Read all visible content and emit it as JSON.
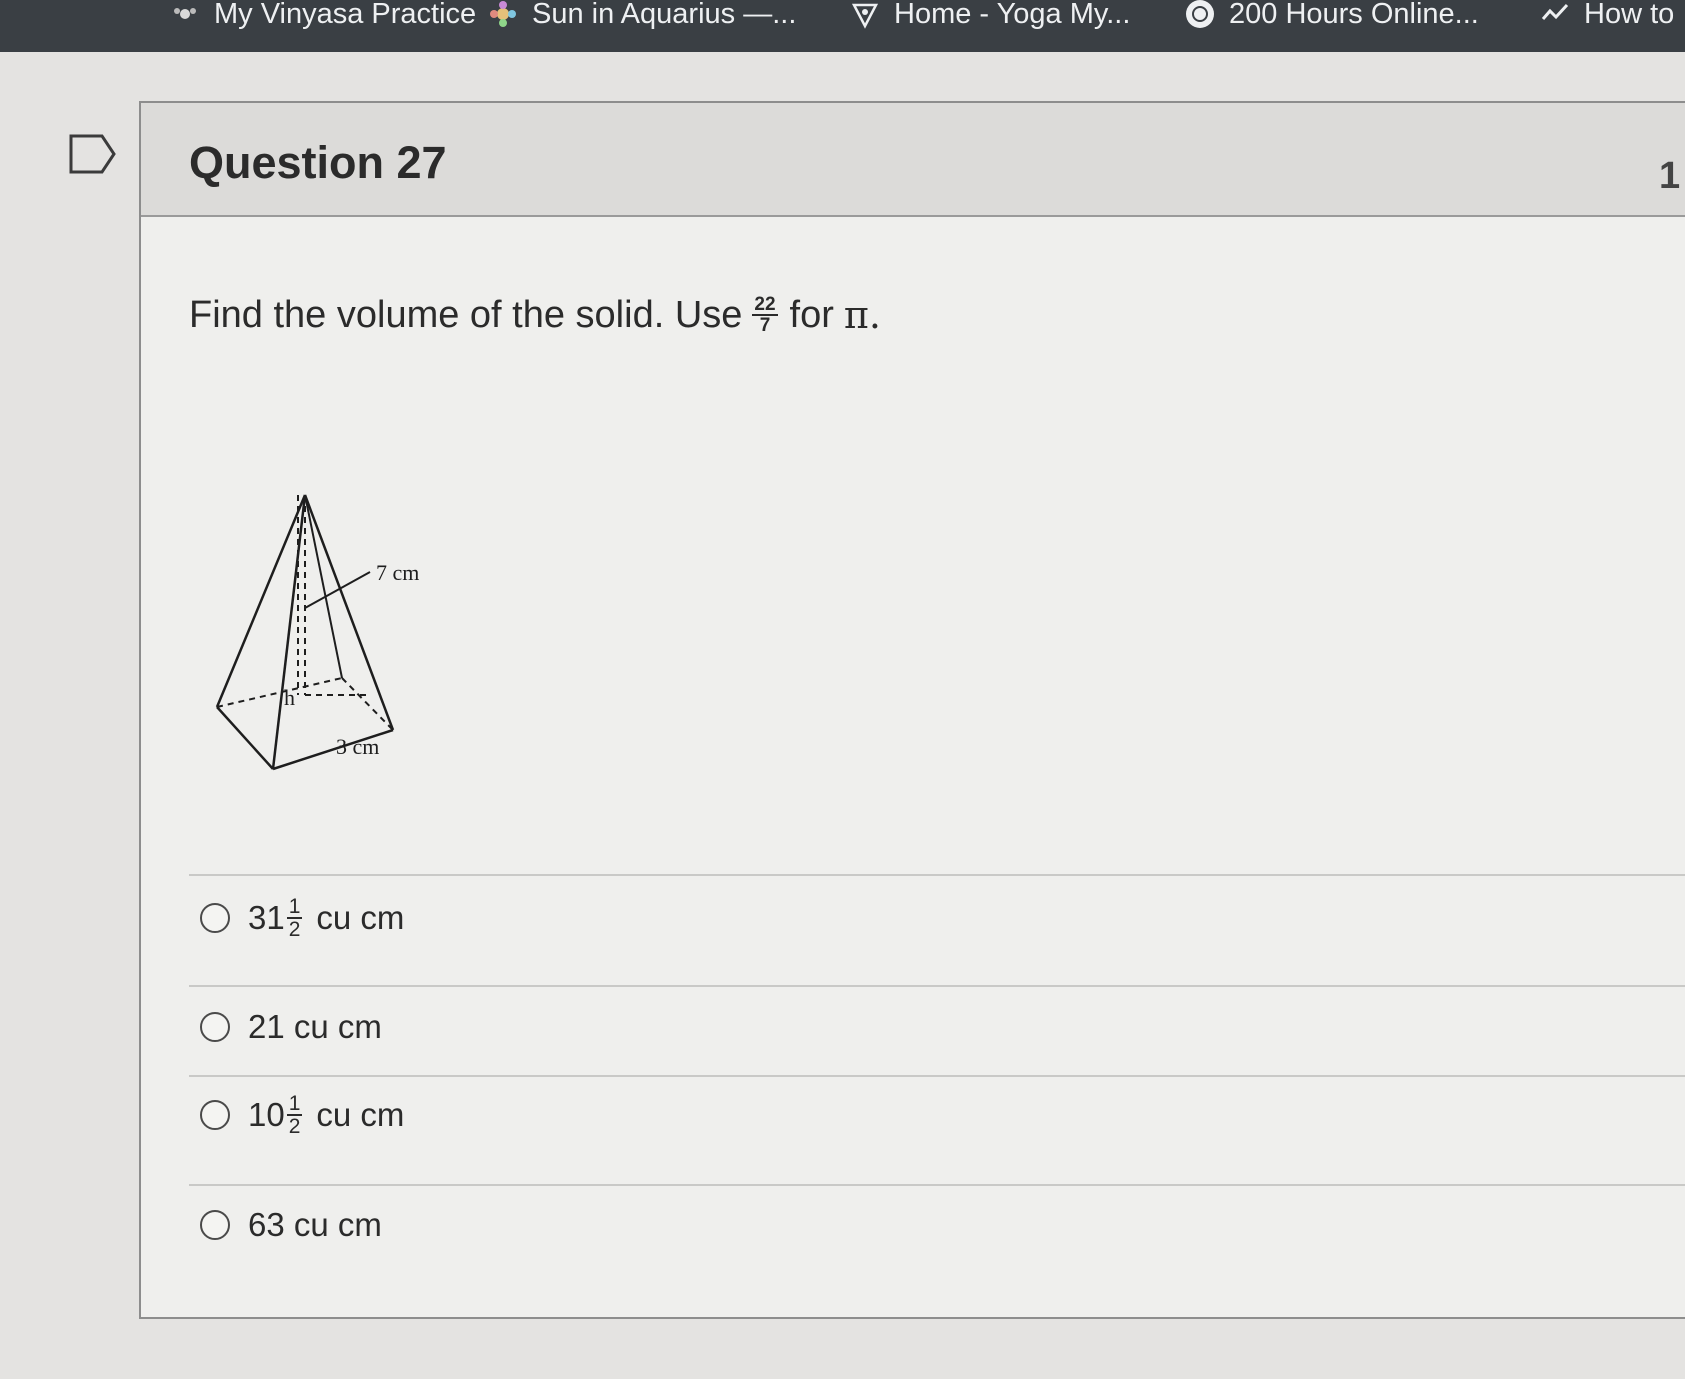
{
  "bookmarks": [
    {
      "label": "My Vinyasa Practice",
      "icon": "lotus-icon"
    },
    {
      "label": "Sun in Aquarius —...",
      "icon": "flower-icon"
    },
    {
      "label": "Home - Yoga My...",
      "icon": "heart-location-icon"
    },
    {
      "label": "200 Hours Online...",
      "icon": "yoga-circle-icon"
    },
    {
      "label": "How to",
      "icon": "check-swoosh-icon"
    }
  ],
  "question": {
    "title": "Question 27",
    "points": "1",
    "prompt_before": "Find the volume of the solid. Use",
    "pi_num": "22",
    "pi_den": "7",
    "prompt_after": "for",
    "pi_symbol": "π."
  },
  "figure": {
    "slant_label": "7 cm",
    "base_label": "3 cm",
    "height_label": "h"
  },
  "options": [
    {
      "whole": "31",
      "num": "1",
      "den": "2",
      "unit": "cu cm"
    },
    {
      "text": "21 cu cm"
    },
    {
      "whole": "10",
      "num": "1",
      "den": "2",
      "unit": "cu cm"
    },
    {
      "text": "63 cu cm"
    }
  ],
  "colors": {
    "bookmarks_bg": "#3a3f44",
    "page_bg": "#e4e3e1",
    "header_bg": "#dcdbd9"
  }
}
